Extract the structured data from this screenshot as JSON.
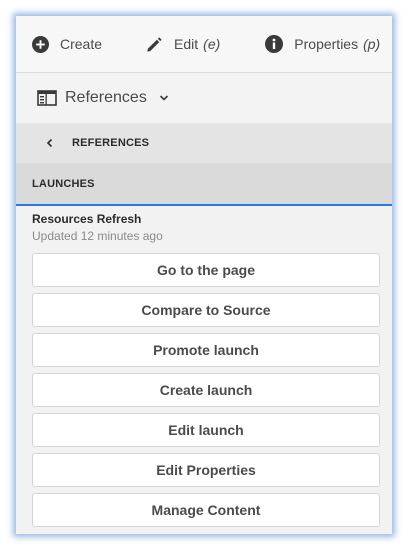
{
  "toolbar": {
    "create_label": "Create",
    "edit_label": "Edit",
    "edit_shortcut": "(e)",
    "properties_label": "Properties",
    "properties_shortcut": "(p)"
  },
  "rail": {
    "selector_label": "References"
  },
  "breadcrumb": {
    "back_label": "REFERENCES"
  },
  "section": {
    "header": "LAUNCHES"
  },
  "launch": {
    "title": "Resources Refresh",
    "updated": "Updated 12 minutes ago",
    "actions": [
      "Go to the page",
      "Compare to Source",
      "Promote launch",
      "Create launch",
      "Edit launch",
      "Edit Properties",
      "Manage Content"
    ]
  },
  "colors": {
    "accent": "#2c78e0",
    "icon": "#4b4b4b"
  },
  "icons": {
    "create": "plus-circle-icon",
    "edit": "pencil-icon",
    "properties": "info-circle-icon",
    "rail": "side-panel-icon",
    "dropdown": "chevron-down-icon",
    "back": "chevron-left-icon"
  }
}
